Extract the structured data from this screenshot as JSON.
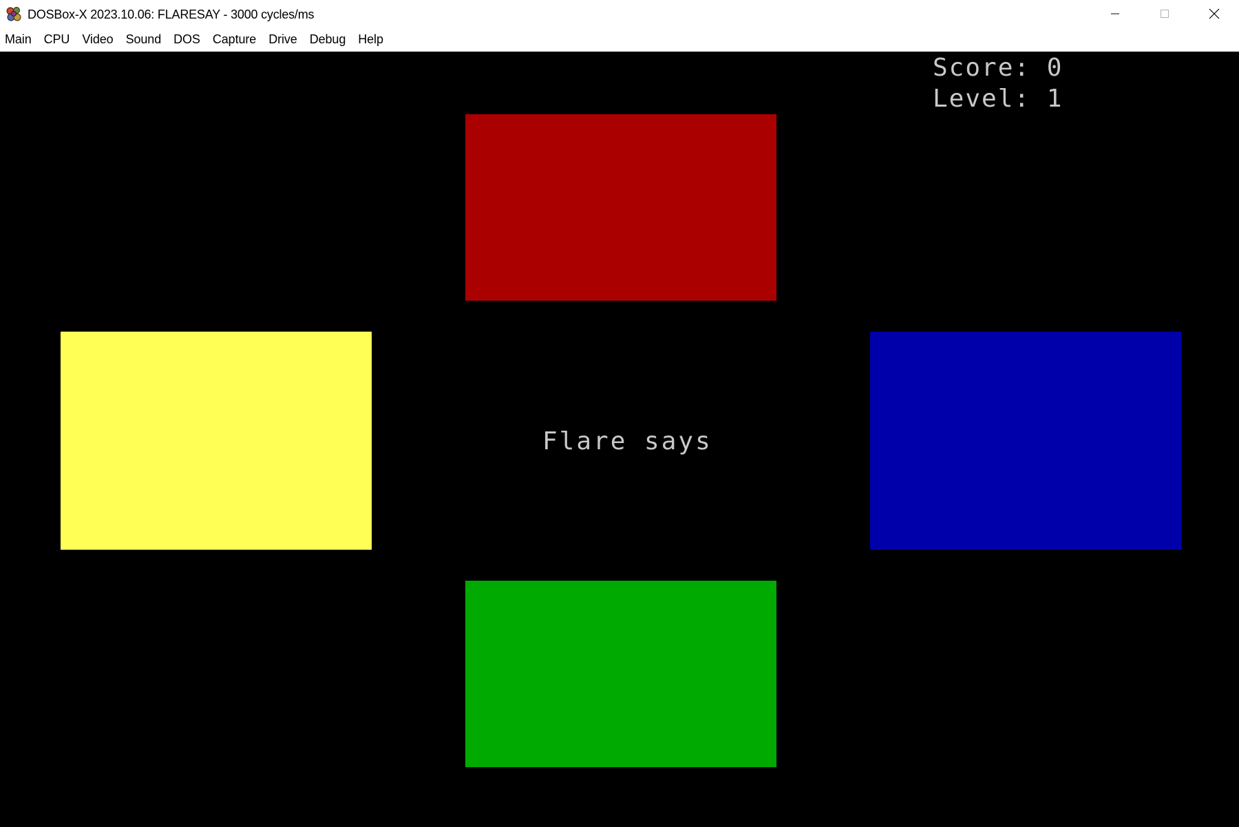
{
  "window": {
    "title": "DOSBox-X 2023.10.06: FLARESAY - 3000 cycles/ms"
  },
  "menu": {
    "items": [
      "Main",
      "CPU",
      "Video",
      "Sound",
      "DOS",
      "Capture",
      "Drive",
      "Debug",
      "Help"
    ]
  },
  "game": {
    "score_text": "Score: 0",
    "level_text": "Level: 1",
    "score": 0,
    "level": 1,
    "message": "Flare says",
    "pads": {
      "red": "#aa0000",
      "yellow": "#ffff55",
      "blue": "#0000aa",
      "green": "#00aa00"
    }
  },
  "colors": {
    "screen_background": "#000000",
    "text": "#c8c8c8"
  }
}
